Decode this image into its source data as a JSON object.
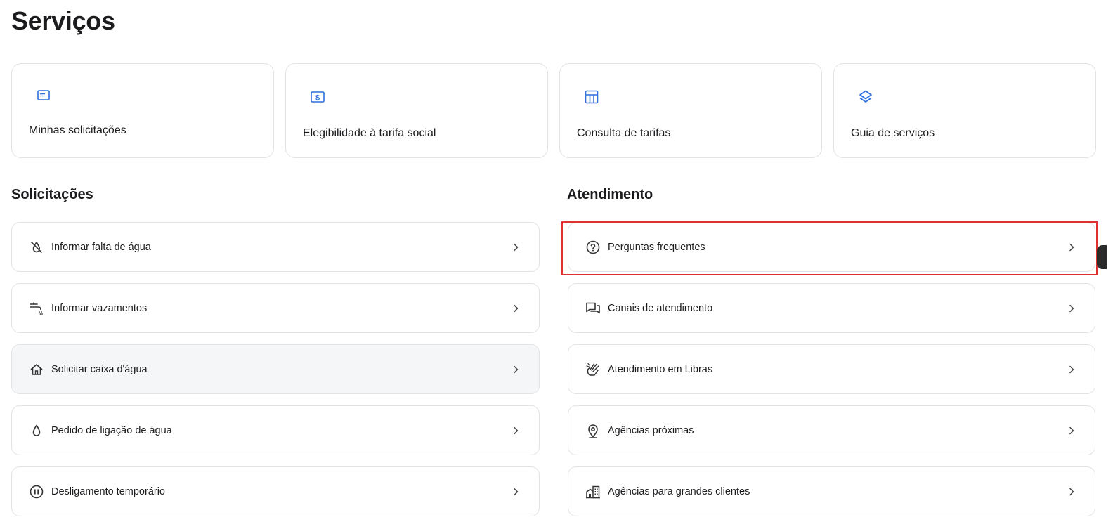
{
  "page": {
    "title": "Serviços"
  },
  "cards": [
    {
      "label": "Minhas solicitações",
      "icon": "window-icon"
    },
    {
      "label": "Elegibilidade à tarifa social",
      "icon": "dollar-bill-icon"
    },
    {
      "label": "Consulta de tarifas",
      "icon": "table-icon"
    },
    {
      "label": "Guia de serviços",
      "icon": "layers-icon"
    }
  ],
  "solicitacoes": {
    "title": "Solicitações",
    "items": [
      {
        "label": "Informar falta de água",
        "icon": "water-off-icon"
      },
      {
        "label": "Informar vazamentos",
        "icon": "tap-leak-icon"
      },
      {
        "label": "Solicitar caixa d'água",
        "icon": "house-icon"
      },
      {
        "label": "Pedido de ligação de água",
        "icon": "droplet-icon"
      },
      {
        "label": "Desligamento temporário",
        "icon": "pause-circle-icon"
      }
    ]
  },
  "atendimento": {
    "title": "Atendimento",
    "items": [
      {
        "label": "Perguntas frequentes",
        "icon": "help-circle-icon"
      },
      {
        "label": "Canais de atendimento",
        "icon": "chat-bubbles-icon"
      },
      {
        "label": "Atendimento em Libras",
        "icon": "sign-language-icon"
      },
      {
        "label": "Agências próximas",
        "icon": "map-pin-icon"
      },
      {
        "label": "Agências para grandes clientes",
        "icon": "buildings-icon"
      }
    ]
  },
  "colors": {
    "accent": "#2f6fde",
    "highlight": "#e03131",
    "border": "#e3e3e6",
    "hover_row": "#f5f6f8"
  }
}
